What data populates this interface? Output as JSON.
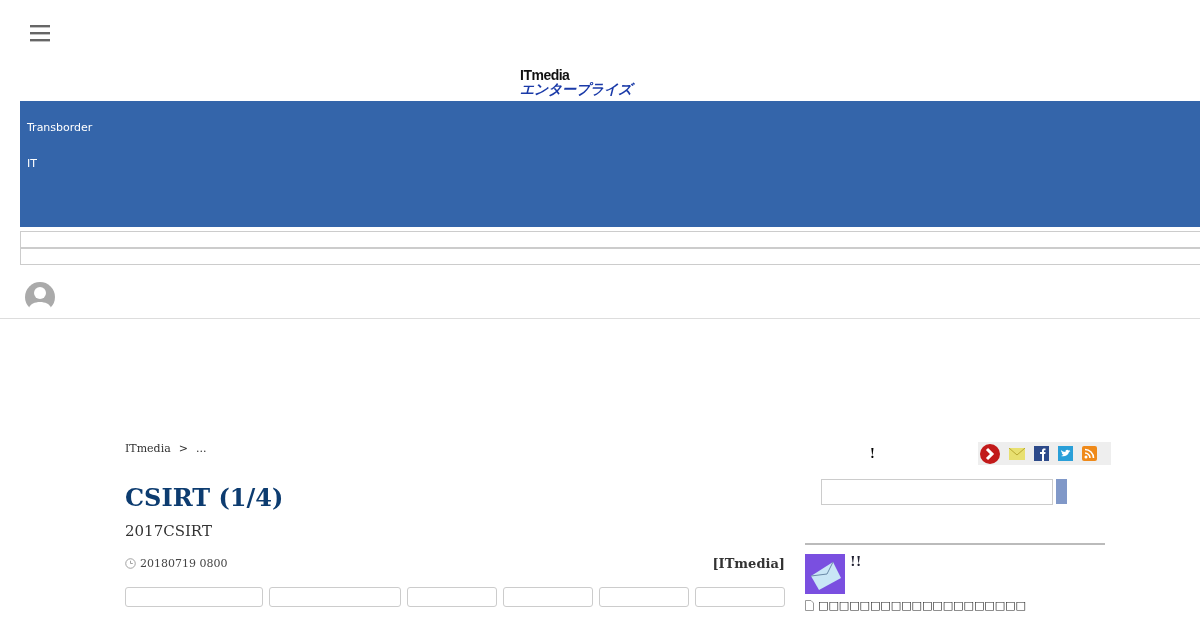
{
  "header": {
    "logo": {
      "top": "ITmedia",
      "bottom": "エンタープライズ"
    }
  },
  "banner": {
    "lines": [
      "Transborder",
      "IT"
    ]
  },
  "breadcrumbs": [
    "ITmedia",
    ">",
    "..."
  ],
  "article": {
    "title": "CSIRT (1/4)",
    "subtitle": "2017CSIRT",
    "date": "20180719 0800",
    "source": "[ITmedia]"
  },
  "sidebar": {
    "notice": "!",
    "newsletter": {
      "title": "!!",
      "line": "□□□□□□□□□□□□□□□□□□□□"
    }
  }
}
